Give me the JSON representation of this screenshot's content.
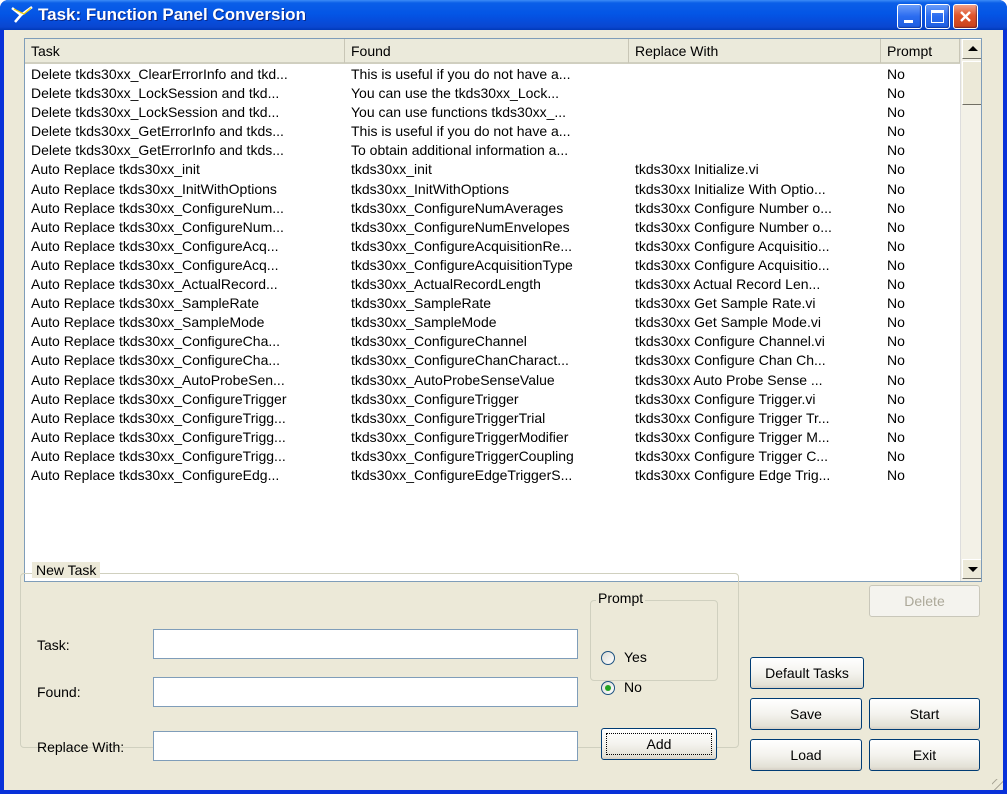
{
  "window": {
    "title": "Task: Function Panel Conversion",
    "icon": "labview-icon",
    "controls": [
      "minimize-icon",
      "maximize-icon",
      "close-icon"
    ]
  },
  "table": {
    "columns": [
      "Task",
      "Found",
      "Replace With",
      "Prompt"
    ],
    "rows": [
      [
        "Delete tkds30xx_ClearErrorInfo and tkd...",
        "This is useful if you do not have a...",
        "",
        "No"
      ],
      [
        "Delete tkds30xx_LockSession and tkd...",
        "You can use the tkds30xx_Lock...",
        "",
        "No"
      ],
      [
        "Delete tkds30xx_LockSession and tkd...",
        "You can use functions tkds30xx_...",
        "",
        "No"
      ],
      [
        "Delete tkds30xx_GetErrorInfo and tkds...",
        "This is useful if you do not have a...",
        "",
        "No"
      ],
      [
        "Delete tkds30xx_GetErrorInfo and tkds...",
        "To obtain additional information a...",
        "",
        "No"
      ],
      [
        "Auto Replace tkds30xx_init",
        "tkds30xx_init",
        "tkds30xx Initialize.vi",
        "No"
      ],
      [
        "Auto Replace tkds30xx_InitWithOptions",
        "tkds30xx_InitWithOptions",
        "tkds30xx Initialize With Optio...",
        "No"
      ],
      [
        "Auto Replace tkds30xx_ConfigureNum...",
        "tkds30xx_ConfigureNumAverages",
        "tkds30xx Configure Number o...",
        "No"
      ],
      [
        "Auto Replace tkds30xx_ConfigureNum...",
        "tkds30xx_ConfigureNumEnvelopes",
        "tkds30xx Configure Number o...",
        "No"
      ],
      [
        "Auto Replace tkds30xx_ConfigureAcq...",
        "tkds30xx_ConfigureAcquisitionRe...",
        "tkds30xx Configure Acquisitio...",
        "No"
      ],
      [
        "Auto Replace tkds30xx_ConfigureAcq...",
        "tkds30xx_ConfigureAcquisitionType",
        "tkds30xx Configure Acquisitio...",
        "No"
      ],
      [
        "Auto Replace tkds30xx_ActualRecord...",
        "tkds30xx_ActualRecordLength",
        "tkds30xx Actual Record Len...",
        "No"
      ],
      [
        "Auto Replace tkds30xx_SampleRate",
        "tkds30xx_SampleRate",
        "tkds30xx Get Sample Rate.vi",
        "No"
      ],
      [
        "Auto Replace tkds30xx_SampleMode",
        "tkds30xx_SampleMode",
        "tkds30xx Get Sample Mode.vi",
        "No"
      ],
      [
        "Auto Replace tkds30xx_ConfigureCha...",
        "tkds30xx_ConfigureChannel",
        "tkds30xx Configure Channel.vi",
        "No"
      ],
      [
        "Auto Replace tkds30xx_ConfigureCha...",
        "tkds30xx_ConfigureChanCharact...",
        "tkds30xx Configure Chan Ch...",
        "No"
      ],
      [
        "Auto Replace tkds30xx_AutoProbeSen...",
        "tkds30xx_AutoProbeSenseValue",
        "tkds30xx Auto Probe Sense ...",
        "No"
      ],
      [
        "Auto Replace tkds30xx_ConfigureTrigger",
        "tkds30xx_ConfigureTrigger",
        "tkds30xx Configure Trigger.vi",
        "No"
      ],
      [
        "Auto Replace tkds30xx_ConfigureTrigg...",
        "tkds30xx_ConfigureTriggerTrial",
        "tkds30xx Configure Trigger Tr...",
        "No"
      ],
      [
        "Auto Replace tkds30xx_ConfigureTrigg...",
        "tkds30xx_ConfigureTriggerModifier",
        "tkds30xx Configure Trigger M...",
        "No"
      ],
      [
        "Auto Replace tkds30xx_ConfigureTrigg...",
        "tkds30xx_ConfigureTriggerCoupling",
        "tkds30xx Configure Trigger C...",
        "No"
      ],
      [
        "Auto Replace tkds30xx_ConfigureEdg...",
        "tkds30xx_ConfigureEdgeTriggerS...",
        "tkds30xx Configure Edge Trig...",
        "No"
      ]
    ]
  },
  "new_task": {
    "group_label": "New Task",
    "task_label": "Task:",
    "found_label": "Found:",
    "replace_label": "Replace With:",
    "task_value": "",
    "found_value": "",
    "replace_value": "",
    "prompt_label": "Prompt",
    "prompt_yes": "Yes",
    "prompt_no": "No",
    "prompt_selected": "No",
    "add_label": "Add"
  },
  "buttons": {
    "delete": "Delete",
    "default_tasks": "Default Tasks",
    "save": "Save",
    "start": "Start",
    "load": "Load",
    "exit": "Exit"
  },
  "colors": {
    "titlebar": "#0a5ee8",
    "face": "#ece9d8",
    "list_border": "#7f9db9"
  }
}
